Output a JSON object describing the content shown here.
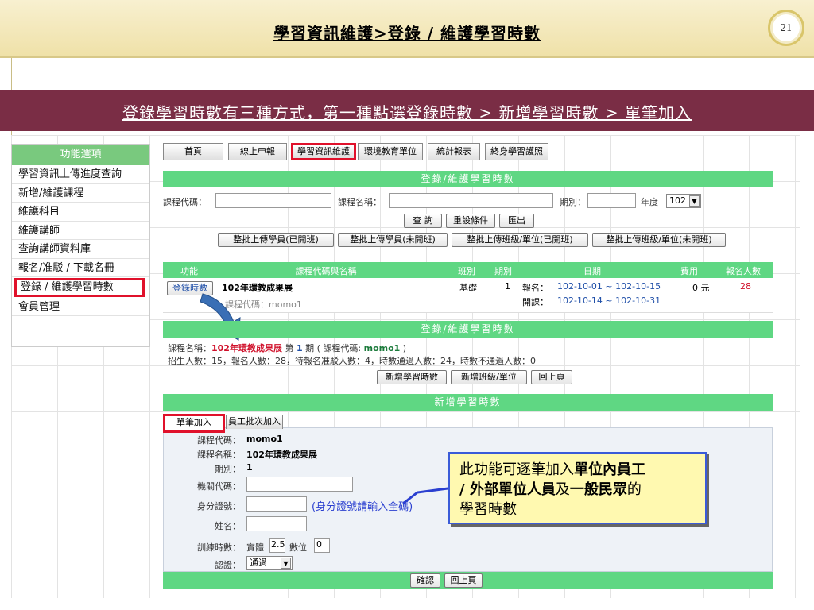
{
  "slide": {
    "title": "學習資訊維護>登錄 / 維護學習時數",
    "page_number": "21",
    "banner": "登錄學習時數有三種方式，第一種點選登錄時數 > 新增學習時數 > 單筆加入"
  },
  "sidebar": {
    "header": "功能選項",
    "items": [
      "學習資訊上傳進度查詢",
      "新增/維護課程",
      "維護科目",
      "維護講師",
      "查詢講師資料庫",
      "報名/准駁 / 下載名冊",
      "登錄 / 維護學習時數",
      "會員管理"
    ]
  },
  "tabs": [
    "首頁",
    "線上申報",
    "學習資訊維護",
    "環境教育單位",
    "統計報表",
    "終身學習護照"
  ],
  "search_panel": {
    "title": "登錄/維護學習時數",
    "course_code_label": "課程代碼：",
    "course_name_label": "課程名稱：",
    "period_label": "期別：",
    "year_label": "年度",
    "year_value": "102",
    "buttons": [
      "查 詢",
      "重設條件",
      "匯出"
    ],
    "upload_buttons": [
      "整批上傳學員(已開班)",
      "整批上傳學員(未開班)",
      "整批上傳班級/單位(已開班)",
      "整批上傳班級/單位(未開班)"
    ]
  },
  "course_table": {
    "headers": [
      "功能",
      "課程代碼與名稱",
      "班別",
      "期別",
      "日期",
      "費用",
      "報名人數"
    ],
    "row": {
      "action": "登錄時數",
      "name": "102年環教成果展",
      "code": "課程代碼：momo1",
      "class": "基礎",
      "period": "1",
      "signup_label": "報名：",
      "signup_dates": "102-10-01 ~ 102-10-15",
      "open_label": "開課：",
      "open_dates": "102-10-14 ~ 102-10-31",
      "fee": "0 元",
      "count": "28"
    }
  },
  "detail_panel": {
    "title": "登錄/維護學習時數",
    "line1": {
      "prefix": "課程名稱：",
      "course": "102年環教成果展",
      "period_pre": " 第 ",
      "period": "1",
      "code_pre": " 期 ( 課程代碼: ",
      "code": "momo1",
      "suffix": " )"
    },
    "line2": "招生人數：15，報名人數：28，待報名准駁人數：4，時數通過人數：24，時數不通過人數：0",
    "buttons": [
      "新增學習時數",
      "新增班級/單位",
      "回上頁"
    ]
  },
  "add_panel": {
    "title": "新增學習時數",
    "tabs": [
      "單筆加入",
      "員工批次加入"
    ],
    "fields": {
      "course_code_label": "課程代碼：",
      "course_code": "momo1",
      "course_name_label": "課程名稱：",
      "course_name": "102年環教成果展",
      "period_label": "期別：",
      "period": "1",
      "agency_label": "機關代碼：",
      "id_label": "身分證號：",
      "id_hint": "(身分證號請輸入全碼)",
      "name_label": "姓名：",
      "hours_label": "訓練時數：",
      "physical_label": "實體",
      "physical_value": "2.5",
      "digital_label": "數位",
      "digital_value": "0",
      "cert_label": "認證：",
      "cert_value": "通過"
    },
    "buttons": [
      "確認",
      "回上頁"
    ]
  },
  "callout": {
    "p1": "此功能可逐筆加入",
    "b1": "單位內員工",
    "b2": "/ 外部單位人員",
    "p2": "及",
    "b3": "一般民眾",
    "p3": "的",
    "p4": "學習時數"
  }
}
